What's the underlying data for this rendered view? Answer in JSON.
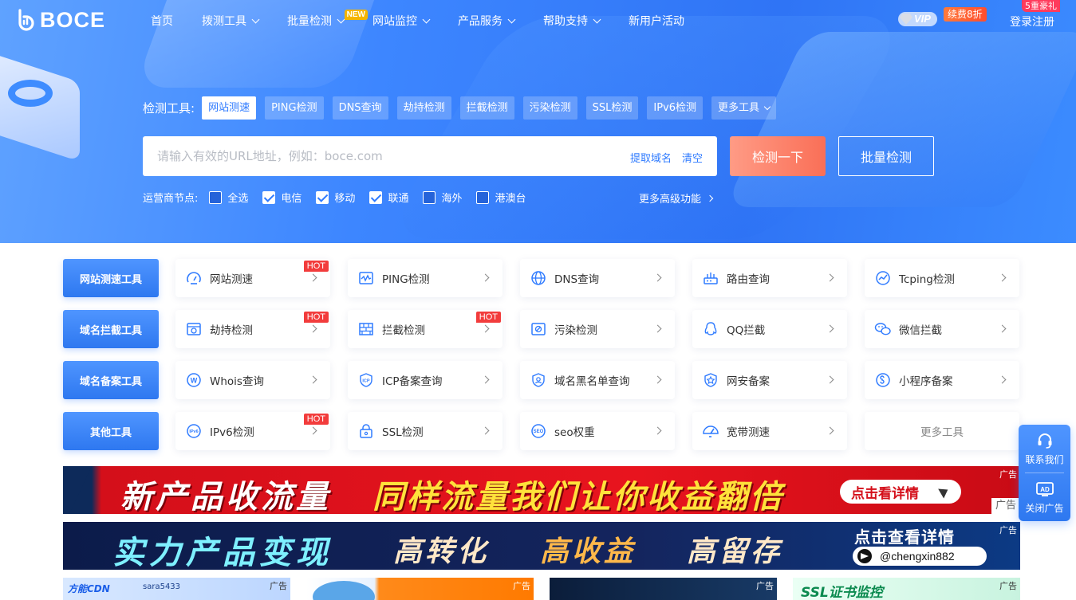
{
  "brand": {
    "name": "BOCE"
  },
  "nav": {
    "items": [
      {
        "label": "首页",
        "dropdown": false
      },
      {
        "label": "拨测工具",
        "dropdown": true
      },
      {
        "label": "批量检测",
        "dropdown": true,
        "badge": "NEW"
      },
      {
        "label": "网站监控",
        "dropdown": true
      },
      {
        "label": "产品服务",
        "dropdown": true
      },
      {
        "label": "帮助支持",
        "dropdown": true
      },
      {
        "label": "新用户活动",
        "dropdown": false
      }
    ],
    "vip": "VIP",
    "renew": "续费8折",
    "gift": "5重豪礼",
    "login": "登录注册"
  },
  "tools": {
    "label": "检测工具:",
    "tabs": [
      "网站测速",
      "PING检测",
      "DNS查询",
      "劫持检测",
      "拦截检测",
      "污染检测",
      "SSL检测",
      "IPv6检测",
      "更多工具"
    ],
    "active": 0
  },
  "search": {
    "placeholder": "请输入有效的URL地址，例如：boce.com",
    "value": "",
    "extract": "提取域名",
    "clear": "清空",
    "check_button": "检测一下",
    "batch_button": "批量检测"
  },
  "carriers": {
    "label": "运营商节点:",
    "options": [
      {
        "label": "全选",
        "checked": false
      },
      {
        "label": "电信",
        "checked": true
      },
      {
        "label": "移动",
        "checked": true
      },
      {
        "label": "联通",
        "checked": true
      },
      {
        "label": "海外",
        "checked": false
      },
      {
        "label": "港澳台",
        "checked": false
      }
    ],
    "more": "更多高级功能"
  },
  "categories": [
    {
      "name": "网站测速工具",
      "tools": [
        {
          "name": "网站测速",
          "icon": "speed-gauge-icon",
          "hot": true
        },
        {
          "name": "PING检测",
          "icon": "ping-wave-icon",
          "hot": false
        },
        {
          "name": "DNS查询",
          "icon": "globe-icon",
          "hot": false
        },
        {
          "name": "路由查询",
          "icon": "router-icon",
          "hot": false
        },
        {
          "name": "Tcping检测",
          "icon": "tcping-icon",
          "hot": false
        }
      ]
    },
    {
      "name": "域名拦截工具",
      "tools": [
        {
          "name": "劫持检测",
          "icon": "hijack-icon",
          "hot": true
        },
        {
          "name": "拦截检测",
          "icon": "firewall-icon",
          "hot": true
        },
        {
          "name": "污染检测",
          "icon": "pollution-icon",
          "hot": false
        },
        {
          "name": "QQ拦截",
          "icon": "qq-icon",
          "hot": false
        },
        {
          "name": "微信拦截",
          "icon": "wechat-icon",
          "hot": false
        }
      ]
    },
    {
      "name": "域名备案工具",
      "tools": [
        {
          "name": "Whois查询",
          "icon": "whois-icon",
          "hot": false
        },
        {
          "name": "ICP备案查询",
          "icon": "icp-shield-icon",
          "hot": false
        },
        {
          "name": "域名黑名单查询",
          "icon": "blacklist-icon",
          "hot": false
        },
        {
          "name": "网安备案",
          "icon": "police-badge-icon",
          "hot": false
        },
        {
          "name": "小程序备案",
          "icon": "mini-program-icon",
          "hot": false
        }
      ]
    },
    {
      "name": "其他工具",
      "tools": [
        {
          "name": "IPv6检测",
          "icon": "ipv6-icon",
          "hot": true
        },
        {
          "name": "SSL检测",
          "icon": "lock-icon",
          "hot": false
        },
        {
          "name": "seo权重",
          "icon": "seo-icon",
          "hot": false
        },
        {
          "name": "宽带测速",
          "icon": "broadband-gauge-icon",
          "hot": false
        },
        {
          "name": "更多工具",
          "icon": "",
          "hot": false,
          "more": true
        }
      ]
    }
  ],
  "hot_label": "HOT",
  "ads": {
    "tag": "广告",
    "banner1": {
      "left": "新产品收流量",
      "right": "同样流量我们让你收益翻倍",
      "cta": "点击看详情",
      "corner": "广告"
    },
    "banner2": {
      "main": "实力产品变现",
      "p1": "高转化",
      "p2": "高收益",
      "p3": "高留存",
      "cta": "点击查看详情",
      "handle": "@chengxin882"
    },
    "small": [
      {
        "text": "方能CDN",
        "sub": "sara5433"
      },
      {
        "text": "",
        "sub": ""
      },
      {
        "text": "",
        "sub": ""
      },
      {
        "text": "SSL证书监控",
        "sub": ""
      }
    ]
  },
  "side": {
    "contact": "联系我们",
    "close_ad": "关闭广告"
  },
  "colors": {
    "primary": "#2f7bff",
    "hot": "#f23c3c",
    "check_button": "#fa6f57"
  }
}
